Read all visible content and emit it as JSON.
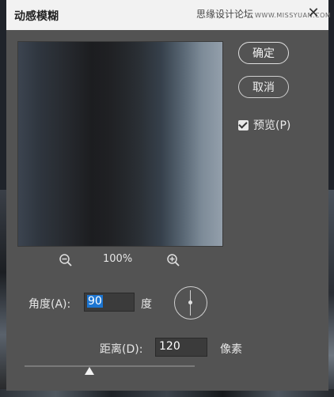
{
  "dialog": {
    "title": "动感模糊",
    "watermark": "思缘设计论坛",
    "watermark_sub": "WWW.MISSYUAN.COM"
  },
  "buttons": {
    "ok_label": "确定",
    "cancel_label": "取消"
  },
  "preview": {
    "label": "预览(P)",
    "checked": true
  },
  "zoom": {
    "value": "100%"
  },
  "angle": {
    "label": "角度(A):",
    "value": "90",
    "unit": "度"
  },
  "distance": {
    "label": "距离(D):",
    "value": "120",
    "unit": "像素",
    "slider_fraction": 0.38
  },
  "icons": {
    "close": "close-icon",
    "zoom_out": "zoom-out-icon",
    "zoom_in": "zoom-in-icon",
    "checkbox": "checkmark-icon"
  },
  "colors": {
    "dialog_bg": "#535353",
    "titlebar_bg": "#f2f2f2",
    "selection": "#1c75d1"
  }
}
